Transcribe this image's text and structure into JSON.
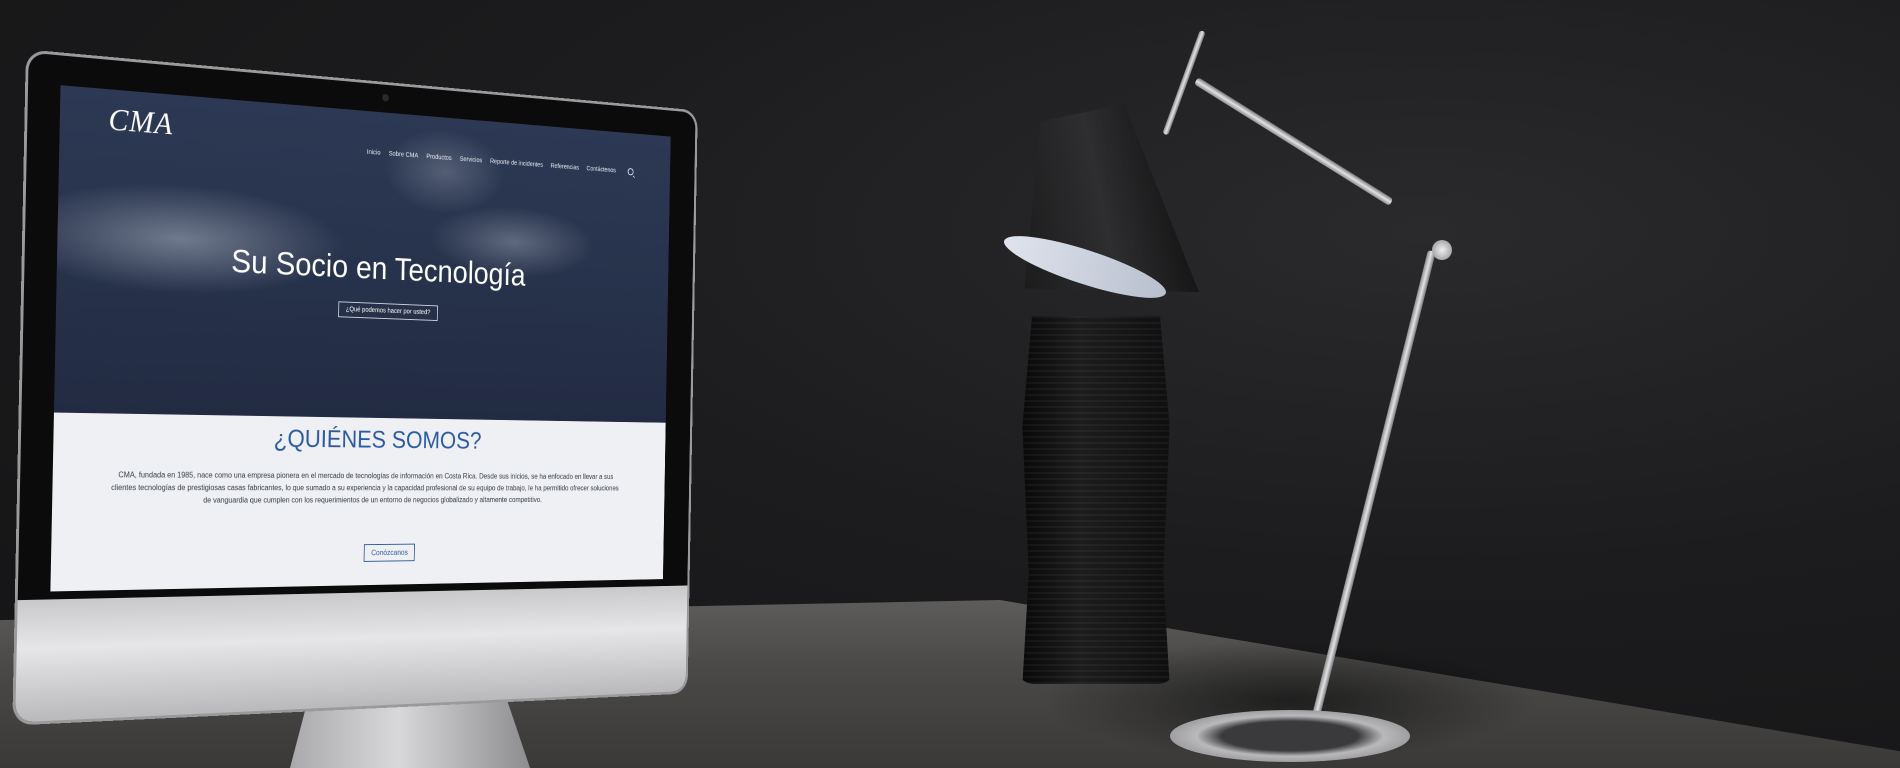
{
  "scene": {
    "description_colors": {
      "wall": "#1c1c1e",
      "desk": "#4a4948",
      "hero_overlay": "#26314a",
      "accent_blue": "#2d5aa0"
    }
  },
  "website": {
    "logo": "CMA",
    "nav": [
      "Inicio",
      "Sobre CMA",
      "Productos",
      "Servicios",
      "Reporte de incidentes",
      "Referencias",
      "Contáctenos"
    ],
    "hero_title": "Su Socio en Tecnología",
    "hero_button": "¿Qué podemos hacer por usted?",
    "about_title": "¿QUIÉNES SOMOS?",
    "about_text": "CMA, fundada en 1985, nace como una empresa pionera en el mercado de tecnologías de información en Costa Rica. Desde sus inicios, se ha enfocado en llevar a sus clientes tecnologías de prestigiosas casas fabricantes, lo que sumado a su experiencia y la capacidad profesional de su equipo de trabajo, le ha permitido ofrecer soluciones de vanguardia que cumplen con los requerimientos de un entorno de negocios globalizado y altamente competitivo.",
    "about_button": "Conózcanos"
  }
}
